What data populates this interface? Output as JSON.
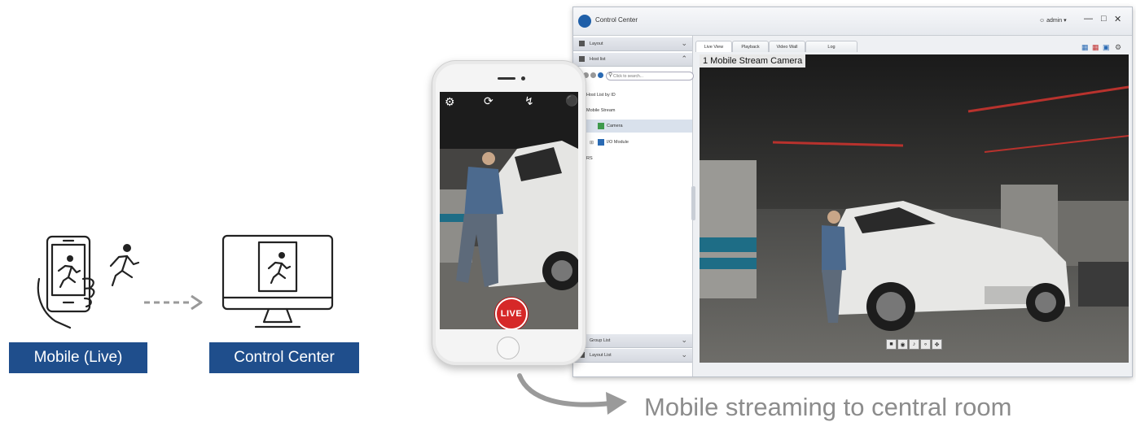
{
  "flow": {
    "mobile_label": "Mobile (Live)",
    "control_label": "Control Center"
  },
  "phone": {
    "live_label": "LIVE",
    "top_icons": [
      "gear-icon",
      "camera-switch-icon",
      "flash-icon",
      "microphone-icon"
    ]
  },
  "window": {
    "title": "Control Center",
    "user": "admin ▾",
    "controls": [
      "minimize",
      "maximize",
      "close"
    ]
  },
  "sidebar": {
    "layout_header": "Layout",
    "host_list_header": "Host list",
    "search_placeholder": "Click to search...",
    "items": [
      {
        "label": "Host List by ID"
      },
      {
        "label": "Mobile Stream"
      },
      {
        "label": "Camera"
      },
      {
        "label": "I/O Module"
      },
      {
        "label": "RS"
      }
    ],
    "group_list": "Group List",
    "layout_list": "Layout List"
  },
  "tabs": [
    {
      "label": "Live View",
      "active": true
    },
    {
      "label": "Playback",
      "active": false
    },
    {
      "label": "Video Wall",
      "active": false
    },
    {
      "label": "Log",
      "active": false
    }
  ],
  "video": {
    "title": "1 Mobile Stream Camera"
  },
  "caption": "Mobile streaming to central room",
  "colors": {
    "brand_blue": "#1f4e8c",
    "live_red": "#d62828"
  }
}
